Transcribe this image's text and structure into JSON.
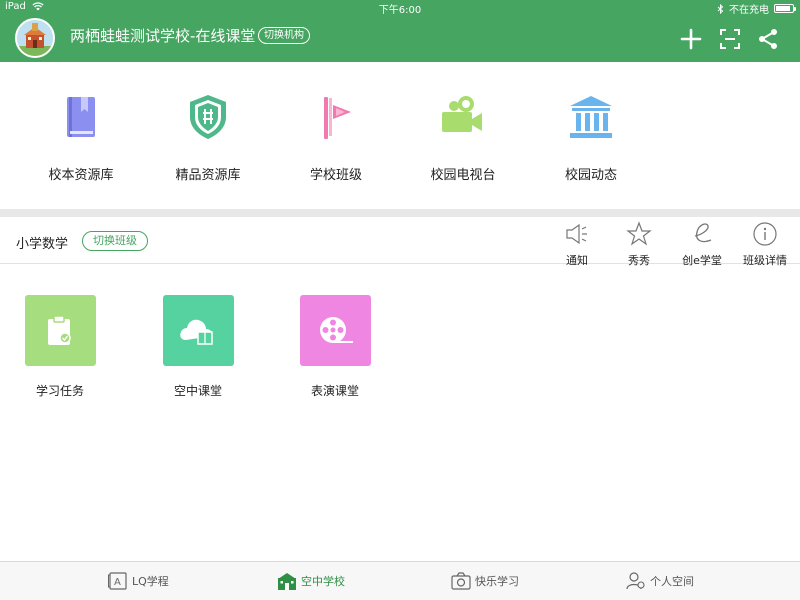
{
  "status_bar": {
    "device": "iPad",
    "time": "下午6:00",
    "charging_status": "不在充电",
    "battery_level": 0.85
  },
  "header": {
    "school_name": "两栖蛙蛙测试学校-在线课堂",
    "switch_org_label": "切换机构",
    "icons": [
      "plus-icon",
      "scan-icon",
      "share-icon"
    ]
  },
  "resources": [
    {
      "label": "校本资源库",
      "icon": "book-icon",
      "color": "#8b8ff0"
    },
    {
      "label": "精品资源库",
      "icon": "shield-icon",
      "color": "#4fb88a"
    },
    {
      "label": "学校班级",
      "icon": "flag-icon",
      "color": "#f07ab0"
    },
    {
      "label": "校园电视台",
      "icon": "camera-icon",
      "color": "#a8dc6c"
    },
    {
      "label": "校园动态",
      "icon": "building-icon",
      "color": "#6ab4ee"
    }
  ],
  "class_bar": {
    "class_name": "小学数学",
    "switch_class_label": "切换班级",
    "actions": [
      {
        "label": "通知",
        "icon": "speaker-icon"
      },
      {
        "label": "秀秀",
        "icon": "star-icon"
      },
      {
        "label": "创e学堂",
        "icon": "e-icon"
      },
      {
        "label": "班级详情",
        "icon": "info-icon"
      }
    ]
  },
  "modules": [
    {
      "label": "学习任务",
      "icon": "task-icon",
      "color": "#a6dd7e"
    },
    {
      "label": "空中课堂",
      "icon": "cloud-book-icon",
      "color": "#55d2a0"
    },
    {
      "label": "表演课堂",
      "icon": "film-reel-icon",
      "color": "#ee86e2"
    }
  ],
  "tabs": [
    {
      "label": "LQ学程",
      "icon": "lq-icon",
      "active": false
    },
    {
      "label": "空中学校",
      "icon": "school-icon",
      "active": true
    },
    {
      "label": "快乐学习",
      "icon": "happy-learn-icon",
      "active": false
    },
    {
      "label": "个人空间",
      "icon": "person-icon",
      "active": false
    }
  ],
  "colors": {
    "header_green": "#45a561",
    "active_tab": "#2f8f45"
  }
}
